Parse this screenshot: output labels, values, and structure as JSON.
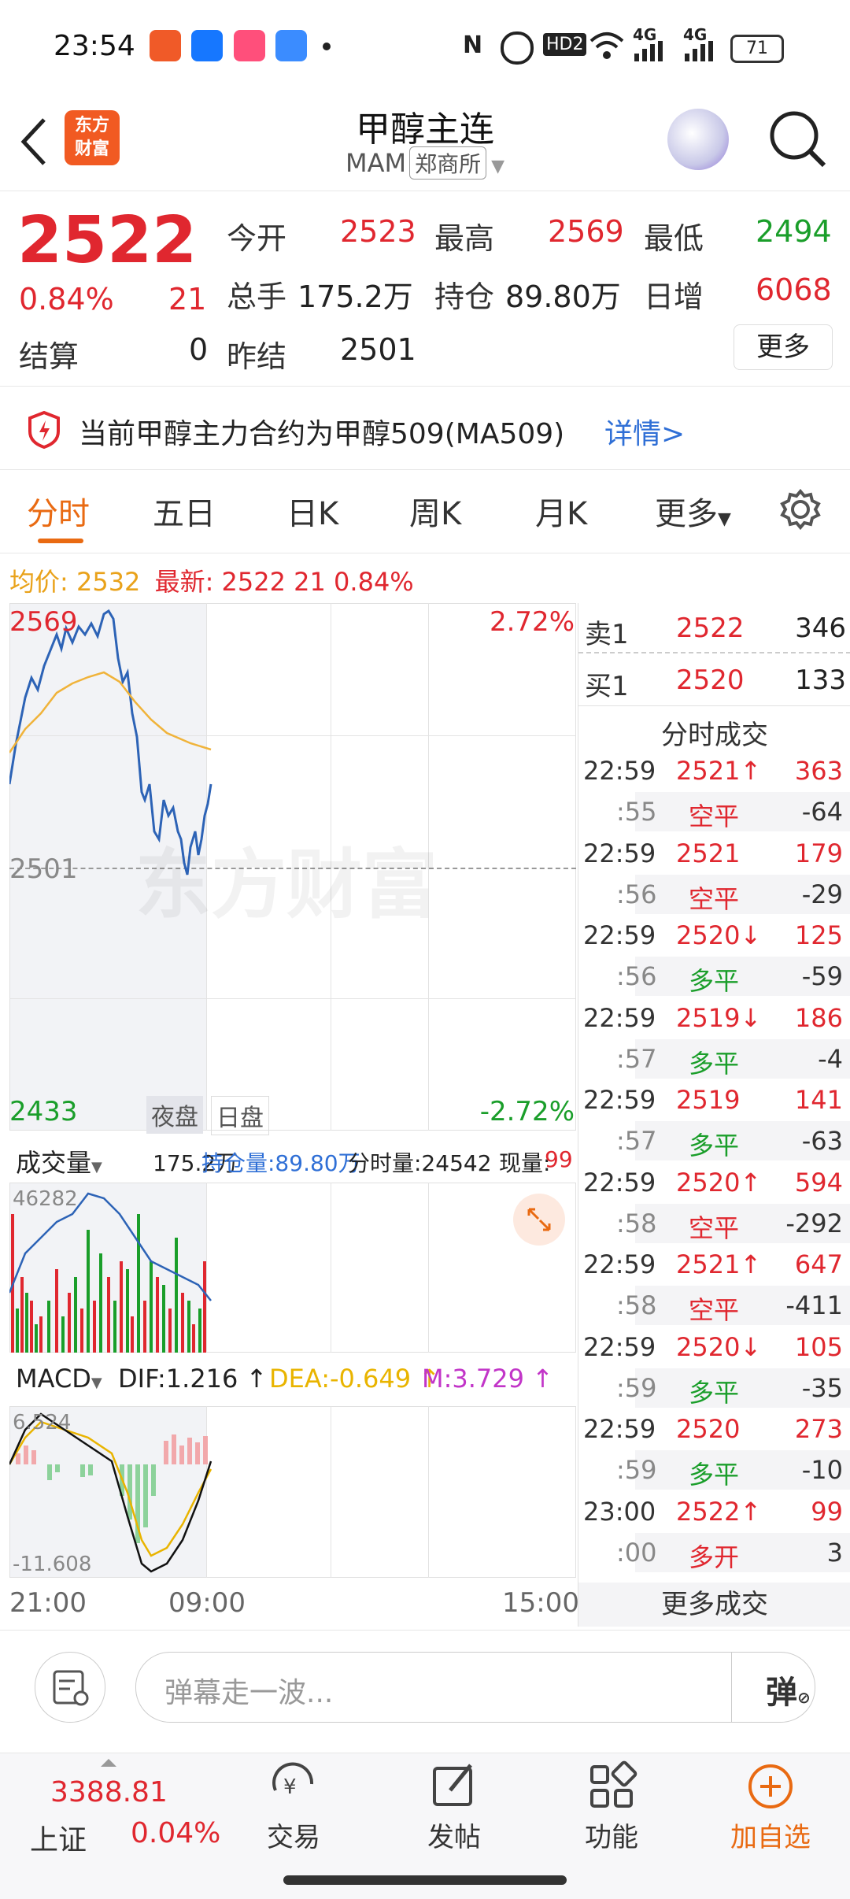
{
  "status": {
    "time": "23:54",
    "battery": "71",
    "net1": "4G",
    "net2": "4G",
    "hd": "HD2"
  },
  "header": {
    "title": "甲醇主连",
    "code": "MAM",
    "exchange": "郑商所",
    "logo_text": "东方\n财富"
  },
  "quote": {
    "price": "2522",
    "pct": "0.84%",
    "chg": "21",
    "settle_label": "结算",
    "settle_value": "0",
    "prev_settle_label": "昨结",
    "prev_settle_value": "2501",
    "open_label": "今开",
    "open_value": "2523",
    "high_label": "最高",
    "high_value": "2569",
    "low_label": "最低",
    "low_value": "2494",
    "vol_label": "总手",
    "vol_value": "175.2万",
    "oi_label": "持仓",
    "oi_value": "89.80万",
    "inc_label": "日增",
    "inc_value": "6068",
    "more_label": "更多"
  },
  "notice": {
    "text": "当前甲醇主力合约为甲醇509(MA509)",
    "link": "详情>"
  },
  "tabs": [
    "分时",
    "五日",
    "日K",
    "周K",
    "月K",
    "更多"
  ],
  "avg_line": {
    "avg_label": "均价:",
    "avg_value": "2532",
    "latest_label": "最新:",
    "latest_value": "2522",
    "chg": "21",
    "pct": "0.84%"
  },
  "chart": {
    "y_high": "2569",
    "y_mid": "2501",
    "y_low": "2433",
    "pct_high": "2.72%",
    "pct_low": "-2.72%",
    "session_night": "夜盘",
    "session_day": "日盘",
    "watermark": "东方财富",
    "x_labels": [
      "21:00",
      "09:00",
      "15:00"
    ]
  },
  "volume_bar": {
    "indicator": "成交量",
    "total": "175.2万",
    "oi": "持仓量:89.80万",
    "fen": "分时量:24542",
    "now_label": "现量:",
    "now_value": "99",
    "vol_max": "46282"
  },
  "macd_bar": {
    "indicator": "MACD",
    "dif": "DIF:1.216",
    "dea": "DEA:-0.649",
    "m": "M:3.729",
    "top": "6.524",
    "bottom": "-11.608"
  },
  "orderbook": {
    "sell_label": "卖1",
    "sell_price": "2522",
    "sell_vol": "346",
    "buy_label": "买1",
    "buy_price": "2520",
    "buy_vol": "133",
    "ticks_title": "分时成交",
    "more": "更多成交"
  },
  "trades": [
    {
      "time": "22:59",
      "price": "2521↑",
      "vol": "363",
      "sec": ":55",
      "type": "空平",
      "chg": "-64",
      "pc": "red",
      "tc": "red"
    },
    {
      "time": "22:59",
      "price": "2521",
      "vol": "179",
      "sec": ":56",
      "type": "空平",
      "chg": "-29",
      "pc": "red",
      "tc": "red"
    },
    {
      "time": "22:59",
      "price": "2520↓",
      "vol": "125",
      "sec": ":56",
      "type": "多平",
      "chg": "-59",
      "pc": "red",
      "tc": "green"
    },
    {
      "time": "22:59",
      "price": "2519↓",
      "vol": "186",
      "sec": ":57",
      "type": "多平",
      "chg": "-4",
      "pc": "red",
      "tc": "green"
    },
    {
      "time": "22:59",
      "price": "2519",
      "vol": "141",
      "sec": ":57",
      "type": "多平",
      "chg": "-63",
      "pc": "red",
      "tc": "green"
    },
    {
      "time": "22:59",
      "price": "2520↑",
      "vol": "594",
      "sec": ":58",
      "type": "空平",
      "chg": "-292",
      "pc": "red",
      "tc": "red"
    },
    {
      "time": "22:59",
      "price": "2521↑",
      "vol": "647",
      "sec": ":58",
      "type": "空平",
      "chg": "-411",
      "pc": "red",
      "tc": "red"
    },
    {
      "time": "22:59",
      "price": "2520↓",
      "vol": "105",
      "sec": ":59",
      "type": "多平",
      "chg": "-35",
      "pc": "red",
      "tc": "green"
    },
    {
      "time": "22:59",
      "price": "2520",
      "vol": "273",
      "sec": ":59",
      "type": "多平",
      "chg": "-10",
      "pc": "red",
      "tc": "green"
    },
    {
      "time": "23:00",
      "price": "2522↑",
      "vol": "99",
      "sec": ":00",
      "type": "多开",
      "chg": "3",
      "pc": "red",
      "tc": "red"
    }
  ],
  "comment": {
    "placeholder": "弹幕走一波...",
    "danmu": "弹"
  },
  "bottom": {
    "index_value": "3388.81",
    "index_name": "上证",
    "index_pct": "0.04%",
    "trade": "交易",
    "post": "发帖",
    "func": "功能",
    "fav": "加自选"
  }
}
